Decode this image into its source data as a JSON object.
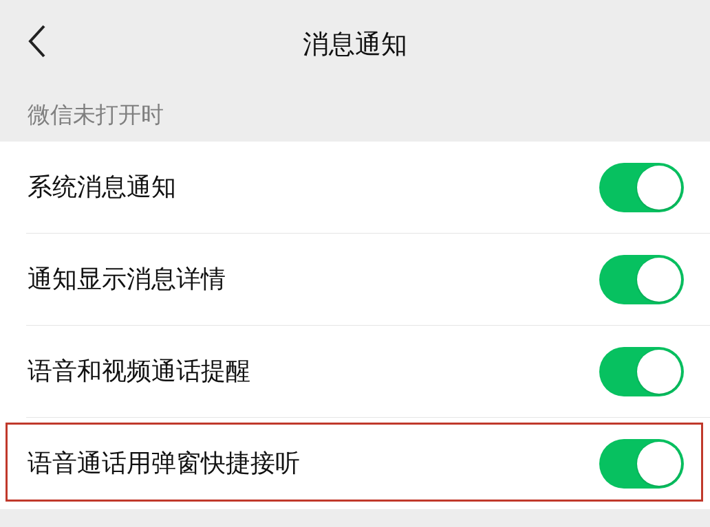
{
  "header": {
    "title": "消息通知"
  },
  "section": {
    "title": "微信未打开时"
  },
  "rows": [
    {
      "label": "系统消息通知",
      "on": true,
      "highlighted": false
    },
    {
      "label": "通知显示消息详情",
      "on": true,
      "highlighted": false
    },
    {
      "label": "语音和视频通话提醒",
      "on": true,
      "highlighted": false
    },
    {
      "label": "语音通话用弹窗快捷接听",
      "on": true,
      "highlighted": true
    }
  ]
}
